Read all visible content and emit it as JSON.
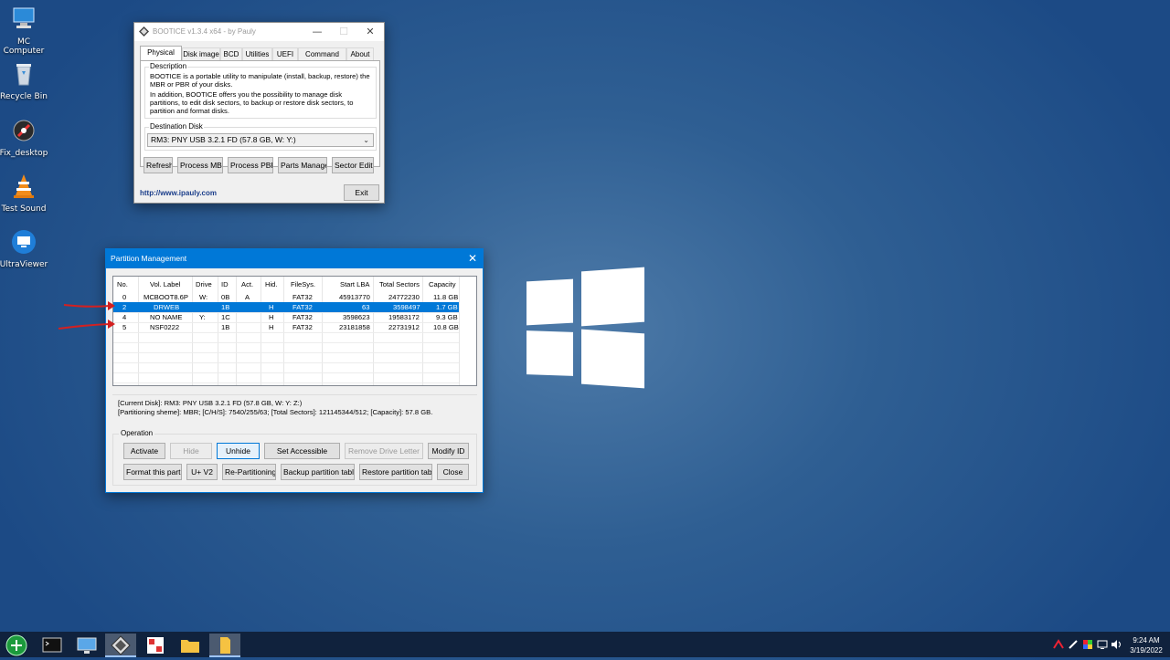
{
  "desktop": {
    "icons": [
      {
        "label": "MC\nComputer",
        "name": "mc-computer"
      },
      {
        "label": "Recycle Bin",
        "name": "recycle-bin"
      },
      {
        "label": "Fix_desktop",
        "name": "fix-desktop"
      },
      {
        "label": "Test Sound",
        "name": "test-sound"
      },
      {
        "label": "UltraViewer",
        "name": "ultraviewer"
      }
    ]
  },
  "bootice": {
    "title": "BOOTICE v1.3.4 x64 - by Pauly",
    "tabs": [
      "Physical disk",
      "Disk image",
      "BCD",
      "Utilities",
      "UEFI",
      "Command line",
      "About"
    ],
    "active_tab": "Physical disk",
    "description_label": "Description",
    "description_p1": "BOOTICE is a portable utility to manipulate (install, backup, restore) the MBR or PBR of your disks.",
    "description_p2": "In addition, BOOTICE offers you the possibility to manage disk partitions, to edit disk sectors, to backup or restore disk sectors, to partition and format disks.",
    "destination_label": "Destination Disk",
    "destination_value": "RM3: PNY USB 3.2.1 FD (57.8 GB, W: Y:)",
    "buttons": {
      "refresh": "Refresh",
      "process_mbr": "Process MBR",
      "process_pbr": "Process PBR",
      "parts_manage": "Parts Manage",
      "sector_edit": "Sector Edit"
    },
    "link": "http://www.ipauly.com",
    "exit": "Exit"
  },
  "partition_manager": {
    "title": "Partition Management",
    "columns": [
      "No.",
      "Vol. Label",
      "Drive",
      "ID",
      "Act.",
      "Hid.",
      "FileSys.",
      "Start LBA",
      "Total Sectors",
      "Capacity"
    ],
    "rows": [
      {
        "no": "0",
        "label": "MCBOOT8.6P",
        "drive": "W:",
        "id": "0B",
        "act": "A",
        "hid": "",
        "fs": "FAT32",
        "start": "45913770",
        "total": "24772230",
        "cap": "11.8 GB",
        "selected": false
      },
      {
        "no": "2",
        "label": "DRWEB",
        "drive": "",
        "id": "1B",
        "act": "",
        "hid": "H",
        "fs": "FAT32",
        "start": "63",
        "total": "3598497",
        "cap": "1.7 GB",
        "selected": true
      },
      {
        "no": "4",
        "label": "NO NAME",
        "drive": "Y:",
        "id": "1C",
        "act": "",
        "hid": "H",
        "fs": "FAT32",
        "start": "3598623",
        "total": "19583172",
        "cap": "9.3 GB",
        "selected": false
      },
      {
        "no": "5",
        "label": "NSF0222",
        "drive": "",
        "id": "1B",
        "act": "",
        "hid": "H",
        "fs": "FAT32",
        "start": "23181858",
        "total": "22731912",
        "cap": "10.8 GB",
        "selected": false
      }
    ],
    "info_line1": "[Current Disk]:    RM3: PNY USB 3.2.1 FD (57.8 GB, W: Y: Z:)",
    "info_line2": "[Partitioning sheme]:     MBR;     [C/H/S]: 7540/255/63; [Total Sectors]: 121145344/512; [Capacity]: 57.8 GB.",
    "operation_label": "Operation",
    "buttons": {
      "activate": "Activate",
      "hide": "Hide",
      "unhide": "Unhide",
      "set_accessible": "Set Accessible",
      "remove_drive_letter": "Remove Drive Letter",
      "modify_id": "Modify ID",
      "format": "Format this part",
      "uv2": "U+ V2",
      "repartition": "Re-Partitioning",
      "backup": "Backup partition table",
      "restore": "Restore partition table",
      "close": "Close"
    }
  },
  "taskbar": {
    "time": "9:24 AM",
    "date": "3/19/2022"
  },
  "colors": {
    "accent": "#0078d7",
    "desktop": "#2f5f93",
    "taskbar": "#10223d"
  }
}
